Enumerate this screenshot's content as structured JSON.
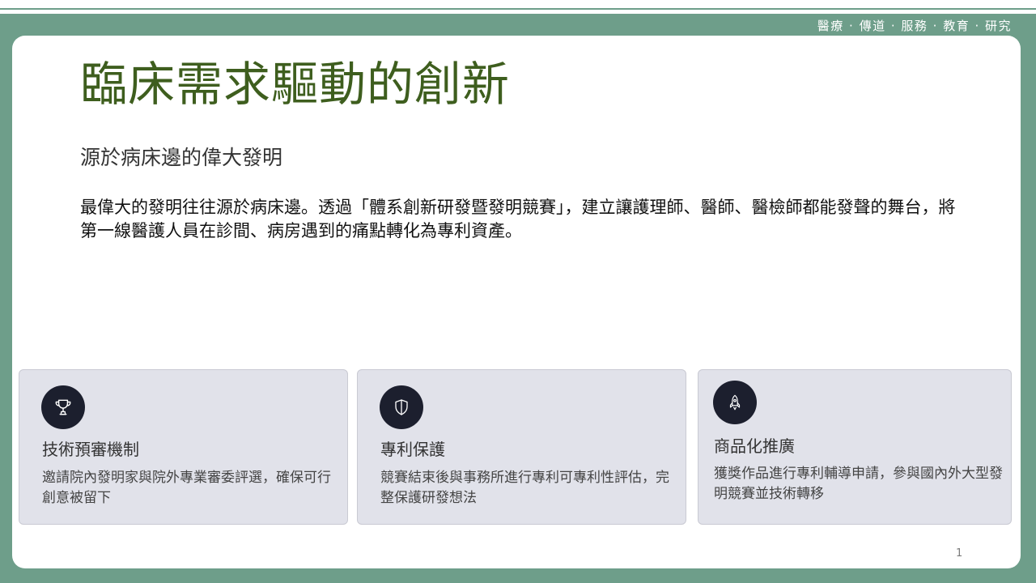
{
  "header": {
    "tagline": "醫療 · 傳道 · 服務 · 教育 · 研究"
  },
  "slide": {
    "title": "臨床需求驅動的創新",
    "subtitle": "源於病床邊的偉大發明",
    "body": "最偉大的發明往往源於病床邊。透過「體系創新研發暨發明競賽」，建立讓護理師、醫師、醫檢師都能發聲的舞台，將第一線醫護人員在診間、病房遇到的痛點轉化為專利資產。",
    "page_number": "1"
  },
  "cards": [
    {
      "icon": "trophy-icon",
      "title": "技術預審機制",
      "desc": "邀請院內發明家與院外專業審委評選，確保可行創意被留下"
    },
    {
      "icon": "shield-icon",
      "title": "專利保護",
      "desc": "競賽結束後與事務所進行專利可專利性評估，完整保護研發想法"
    },
    {
      "icon": "rocket-icon",
      "title": "商品化推廣",
      "desc": "獲獎作品進行專利輔導申請，參與國內外大型發明競賽並技術轉移"
    }
  ],
  "colors": {
    "frame": "#6e9e8a",
    "title": "#3e5e1e",
    "card_bg": "#e1e2ea",
    "icon_bg": "#1c1f2e"
  }
}
